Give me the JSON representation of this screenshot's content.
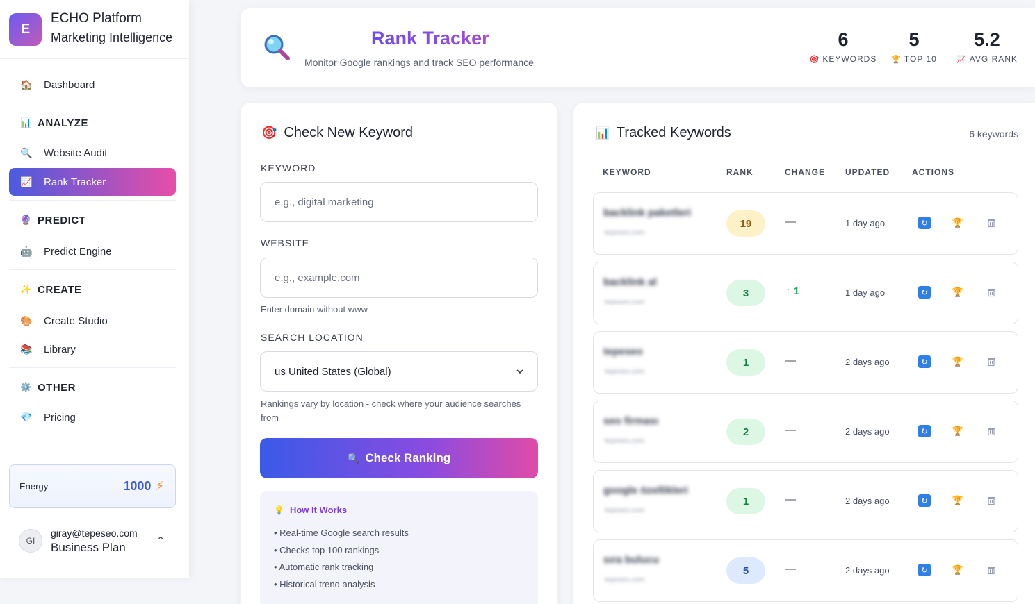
{
  "brand": {
    "logo_letter": "E",
    "name": "ECHO Platform",
    "subtitle": "Marketing Intelligence"
  },
  "sidebar": {
    "dashboard": {
      "label": "Dashboard",
      "icon": "house-icon"
    },
    "sections": [
      {
        "title": "ANALYZE",
        "icon": "bar-chart-icon",
        "items": [
          {
            "label": "Website Audit",
            "icon": "magnifier-icon"
          },
          {
            "label": "Rank Tracker",
            "icon": "chart-up-icon",
            "active": true
          }
        ]
      },
      {
        "title": "PREDICT",
        "icon": "crystal-ball-icon",
        "items": [
          {
            "label": "Predict Engine",
            "icon": "robot-icon"
          }
        ]
      },
      {
        "title": "CREATE",
        "icon": "sparkles-icon",
        "items": [
          {
            "label": "Create Studio",
            "icon": "palette-icon"
          },
          {
            "label": "Library",
            "icon": "books-icon"
          }
        ]
      },
      {
        "title": "OTHER",
        "icon": "gear-icon",
        "items": [
          {
            "label": "Pricing",
            "icon": "diamond-icon"
          }
        ]
      }
    ],
    "energy": {
      "label": "Energy",
      "value": "1000"
    },
    "user": {
      "initials": "GI",
      "email": "giray@tepeseo.com",
      "plan": "Business Plan"
    }
  },
  "header": {
    "title": "Rank Tracker",
    "subtitle": "Monitor Google rankings and track SEO performance",
    "stats": [
      {
        "value": "6",
        "label": "KEYWORDS",
        "icon": "target-icon"
      },
      {
        "value": "5",
        "label": "TOP 10",
        "icon": "trophy-icon"
      },
      {
        "value": "5.2",
        "label": "AVG RANK",
        "icon": "chart-up-icon"
      }
    ]
  },
  "check": {
    "title": "Check New Keyword",
    "keyword_label": "KEYWORD",
    "keyword_placeholder": "e.g., digital marketing",
    "website_label": "WEBSITE",
    "website_placeholder": "e.g., example.com",
    "website_hint": "Enter domain without www",
    "location_label": "SEARCH LOCATION",
    "location_value": "us United States (Global)",
    "location_hint": "Rankings vary by location - check where your audience searches from",
    "button_label": "Check Ranking",
    "how": {
      "title": "How It Works",
      "items": [
        "Real-time Google search results",
        "Checks top 100 rankings",
        "Automatic rank tracking",
        "Historical trend analysis"
      ]
    }
  },
  "tracked": {
    "title": "Tracked Keywords",
    "count": "6 keywords",
    "columns": [
      "KEYWORD",
      "RANK",
      "CHANGE",
      "UPDATED",
      "ACTIONS"
    ],
    "rows": [
      {
        "keyword": "backlink paketleri",
        "site": "tepeseo.com",
        "rank": "19",
        "rank_color": "yellow",
        "change": "—",
        "change_up": false,
        "updated": "1 day ago"
      },
      {
        "keyword": "backlink al",
        "site": "tepeseo.com",
        "rank": "3",
        "rank_color": "green",
        "change": "↑ 1",
        "change_up": true,
        "updated": "1 day ago"
      },
      {
        "keyword": "tepeseo",
        "site": "tepeseo.com",
        "rank": "1",
        "rank_color": "green",
        "change": "—",
        "change_up": false,
        "updated": "2 days ago"
      },
      {
        "keyword": "seo firması",
        "site": "tepeseo.com",
        "rank": "2",
        "rank_color": "green",
        "change": "—",
        "change_up": false,
        "updated": "2 days ago"
      },
      {
        "keyword": "google özellikleri",
        "site": "tepeseo.com",
        "rank": "1",
        "rank_color": "green",
        "change": "—",
        "change_up": false,
        "updated": "2 days ago"
      },
      {
        "keyword": "sıra bulucu",
        "site": "tepeseo.com",
        "rank": "5",
        "rank_color": "blue",
        "change": "—",
        "change_up": false,
        "updated": "2 days ago"
      }
    ]
  }
}
